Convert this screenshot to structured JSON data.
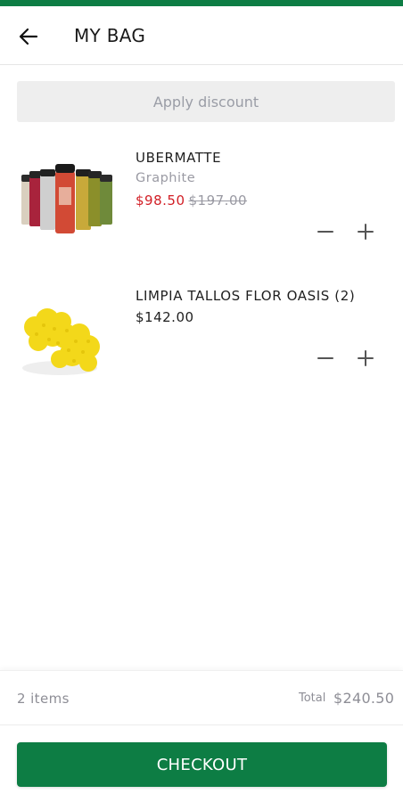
{
  "header": {
    "title": "MY BAG",
    "back_icon": "arrow-left-icon"
  },
  "discount": {
    "label": "Apply discount"
  },
  "bag": {
    "items": [
      {
        "name": "UBERMATTE",
        "variant": "Graphite",
        "sale_price": "$98.50",
        "original_price": "$197.00",
        "image": "spray-bottles-image"
      },
      {
        "name": "LIMPIA TALLOS FLOR OASIS (2)",
        "price": "$142.00",
        "image": "yellow-sponge-image"
      }
    ]
  },
  "summary": {
    "count": "2 items",
    "total_label": "Total",
    "total_value": "$240.50"
  },
  "checkout": {
    "label": "CHECKOUT"
  },
  "colors": {
    "brand_green": "#0d7d44",
    "sale_red": "#d21f26",
    "muted": "#9a9aa3"
  }
}
